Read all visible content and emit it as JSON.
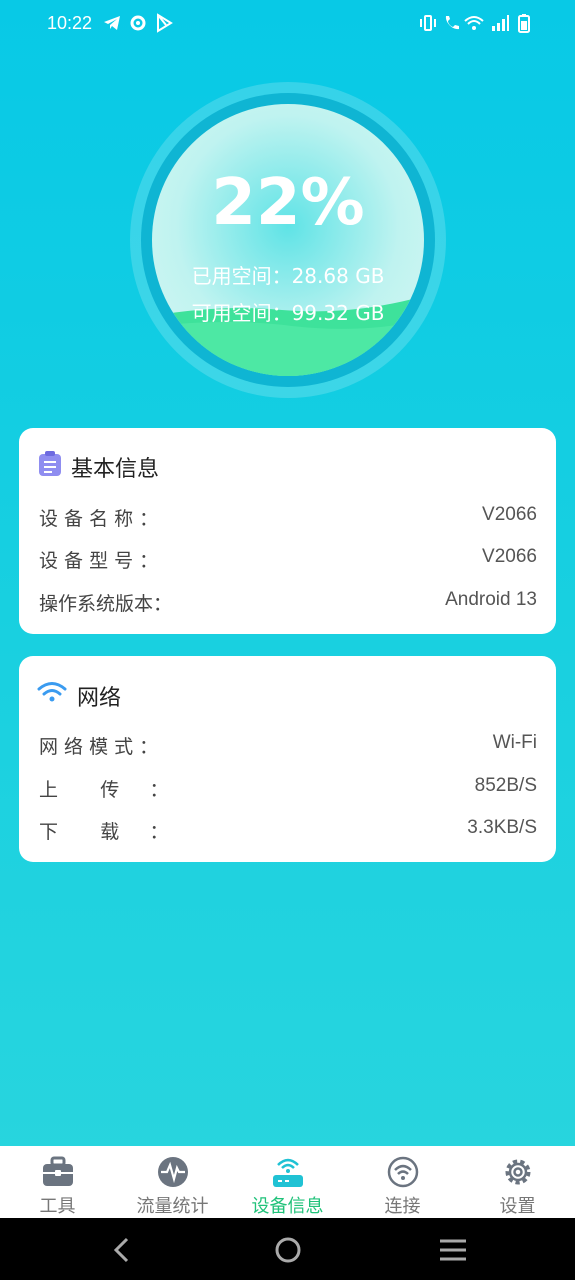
{
  "status_bar": {
    "time": "10:22",
    "left_icons": [
      "telegram-icon",
      "gear-icon",
      "play-store-icon"
    ],
    "right_icons": [
      "vibrate-icon",
      "wifi-call-icon",
      "wifi-icon",
      "signal-icon",
      "battery-icon"
    ]
  },
  "gauge": {
    "percent_text": "22%",
    "percent_value": 22,
    "used_line": "已用空间：28.68 GB",
    "free_line": "可用空间：99.32 GB"
  },
  "basic_info": {
    "title": "基本信息",
    "icon": "clipboard-icon",
    "rows": [
      {
        "label": "设 备 名 称 ：",
        "value": "V2066"
      },
      {
        "label": "设 备 型 号 ：",
        "value": "V2066"
      },
      {
        "label": "操作系统版本：",
        "value": "Android 13"
      }
    ]
  },
  "network": {
    "title": "网络",
    "icon": "wifi-icon",
    "rows": [
      {
        "label": "网 络 模 式 ：",
        "value": "Wi-Fi"
      },
      {
        "label": "上       传     ：",
        "value": "852B/S"
      },
      {
        "label": "下       载     ：",
        "value": "3.3KB/S"
      }
    ]
  },
  "bottom_nav": {
    "items": [
      {
        "label": "工具",
        "icon": "toolbox-icon",
        "active": false
      },
      {
        "label": "流量统计",
        "icon": "pulse-icon",
        "active": false
      },
      {
        "label": "设备信息",
        "icon": "router-icon",
        "active": true
      },
      {
        "label": "连接",
        "icon": "wifi-circle-icon",
        "active": false
      },
      {
        "label": "设置",
        "icon": "gear-icon",
        "active": false
      }
    ]
  },
  "colors": {
    "background": "#19d0e0",
    "accent_active": "#20c27a",
    "ring": "#0fb5d3"
  }
}
